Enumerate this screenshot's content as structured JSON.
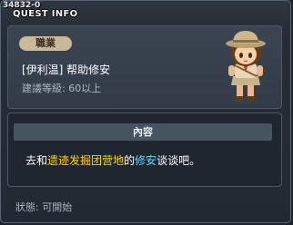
{
  "window": {
    "quest_id": "34832-0",
    "title": "QUEST INFO"
  },
  "info": {
    "job_label": "職業",
    "npc_name": "[伊利温] 帮助修安",
    "level_requirement": "建議等級: 60以上"
  },
  "content": {
    "header": "內容",
    "text_prefix": "去和",
    "location": "遗迹发掘团营地",
    "text_middle": "的",
    "npc": "修安",
    "text_suffix": "谈谈吧。"
  },
  "status": {
    "text": "狀態:  可開始"
  },
  "colors": {
    "highlight_location": "#ffd400",
    "highlight_npc": "#6ad2ff",
    "job_badge": "#c9b99a"
  }
}
